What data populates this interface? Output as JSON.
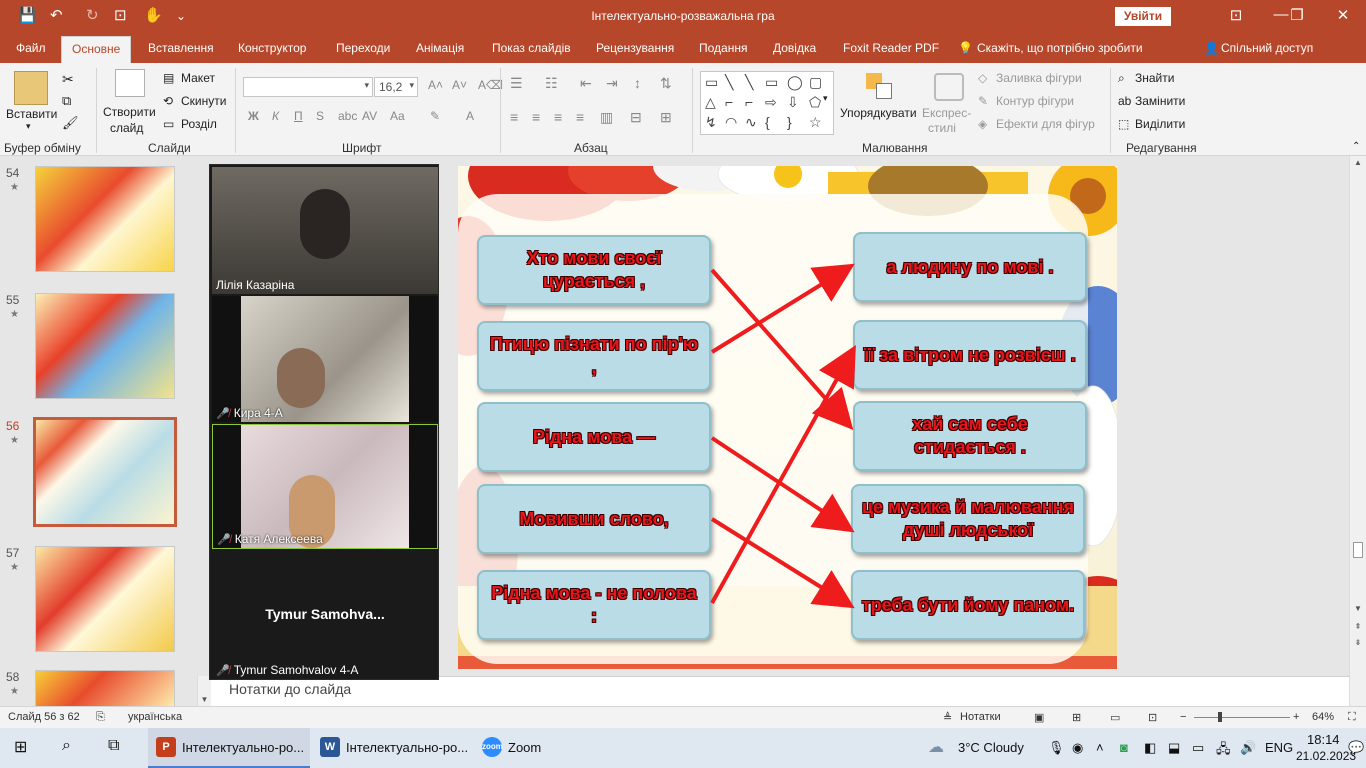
{
  "window": {
    "title": "Інтелектуально-розважальна гра",
    "signin": "Увійти"
  },
  "quick_access": {
    "save": "💾",
    "undo": "↶",
    "redo": "↻",
    "present": "⊡",
    "touch": "✋",
    "more": "⌄"
  },
  "tabs": [
    "Файл",
    "Основне",
    "Вставлення",
    "Конструктор",
    "Переходи",
    "Анімація",
    "Показ слайдів",
    "Рецензування",
    "Подання",
    "Довідка",
    "Foxit Reader PDF"
  ],
  "tell_me": "Скажіть, що потрібно зробити",
  "share": "Спільний доступ",
  "ribbon": {
    "clipboard": {
      "paste": "Вставити",
      "group": "Буфер обміну"
    },
    "slides": {
      "new_slide": "Створити",
      "new_slide2": "слайд",
      "layout": "Макет",
      "reset": "Скинути",
      "section": "Розділ",
      "group": "Слайди"
    },
    "font": {
      "name": "",
      "size": "16,2",
      "bold": "Ж",
      "italic": "К",
      "underline": "П",
      "strike": "S",
      "group": "Шрифт"
    },
    "paragraph": {
      "group": "Абзац"
    },
    "drawing": {
      "arrange": "Упорядкувати",
      "styles": "Експрес-",
      "styles2": "стилі",
      "fill": "Заливка фігури",
      "outline": "Контур фігури",
      "effects": "Ефекти для фігур",
      "group": "Малювання"
    },
    "editing": {
      "find": "Знайти",
      "replace": "Замінити",
      "select": "Виділити",
      "group": "Редагування"
    }
  },
  "slides_panel": {
    "numbers": [
      "54",
      "55",
      "56",
      "57",
      "58"
    ],
    "active": "56"
  },
  "slide": {
    "left": [
      "Хто мови своєї цурається ,",
      "Птицю пізнати по пір'ю ,",
      "Рідна мова —",
      "Мовивши слово,",
      "Рідна мова - не полова :"
    ],
    "right": [
      "а людину по мові .",
      "її за вітром не розвієш .",
      "хай сам себе стидається .",
      "це музика й малювання душі людської",
      "треба бути йому паном."
    ]
  },
  "participants": [
    {
      "name": "Лілія Казаріна"
    },
    {
      "name": "Кира 4-А"
    },
    {
      "name": "Катя Алексеева"
    },
    {
      "display": "Tymur  Samohva...",
      "name": "Tymur Samohvalov 4-A"
    }
  ],
  "notes": "Нотатки до слайда",
  "status": {
    "slide": "Слайд 56 з 62",
    "language": "українська",
    "notes": "Нотатки",
    "zoom": "64%"
  },
  "taskbar": {
    "apps": [
      "Інтелектуально-ро...",
      "Інтелектуально-ро...",
      "Zoom"
    ],
    "weather": "3°C  Cloudy",
    "lang": "ENG",
    "time": "18:14",
    "date": "21.02.2023"
  },
  "colors": {
    "accent": "#b7472a",
    "slide_text": "#e8151b",
    "box": "#b9dce6",
    "arrow": "#ee1c1c"
  }
}
